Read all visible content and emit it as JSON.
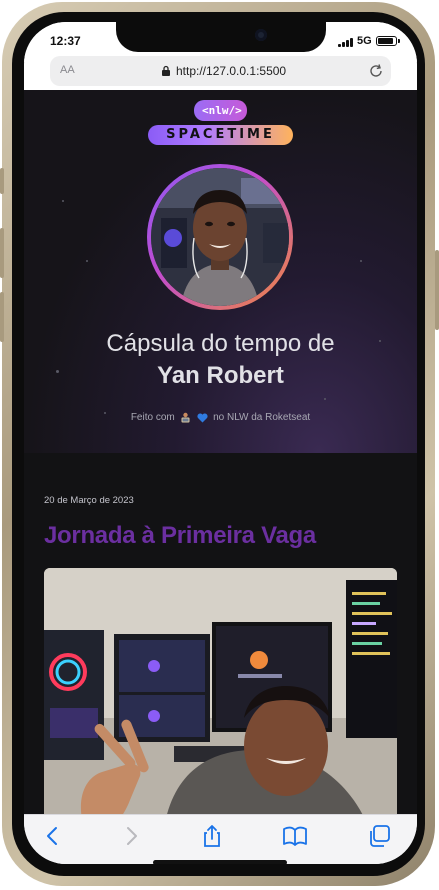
{
  "status_bar": {
    "time": "12:37",
    "network": "5G"
  },
  "browser": {
    "text_size_label": "AA",
    "url": "http://127.0.0.1:5500"
  },
  "hero": {
    "logo_badge": "<nlw/>",
    "logo_wordmark": "SPACETIME",
    "title_line1": "Cápsula do tempo de",
    "title_line2": "Yan Robert",
    "credits_prefix": "Feito com",
    "credits_suffix": "no NLW da Roketseat"
  },
  "post": {
    "date": "20 de Março de 2023",
    "title": "Jornada à Primeira Vaga"
  },
  "colors": {
    "background": "#121214",
    "post_title": "#6b2fa0",
    "accent_purple": "#8b5cf6",
    "accent_orange": "#f08a3c"
  },
  "toolbar": {
    "items": [
      "back-icon",
      "forward-icon",
      "share-icon",
      "bookmarks-icon",
      "tabs-icon"
    ]
  }
}
